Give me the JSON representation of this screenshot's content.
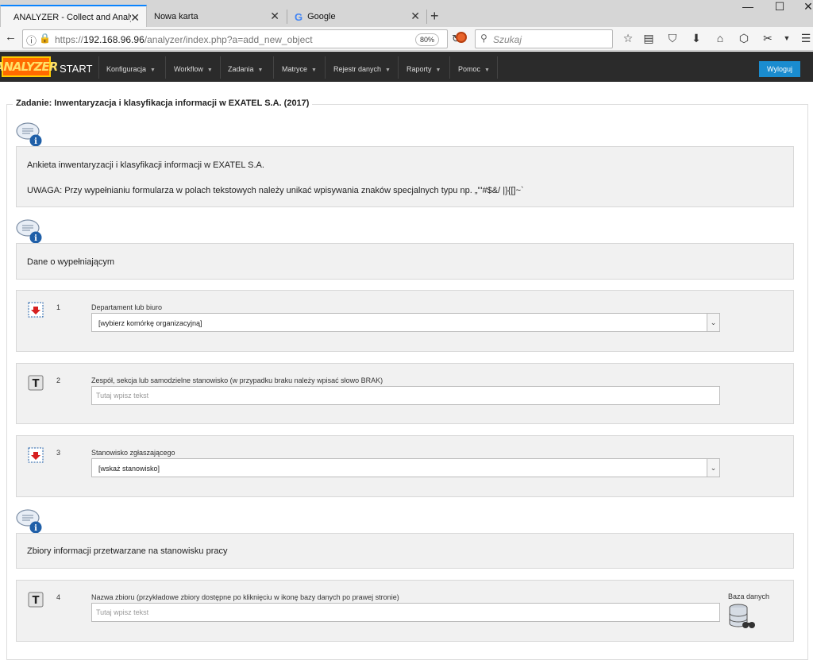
{
  "browser": {
    "tabs": [
      {
        "title": "ANALYZER - Collect and Analysis",
        "active": true
      },
      {
        "title": "Nowa karta",
        "active": false
      },
      {
        "title": "Google",
        "active": false
      }
    ],
    "new_tab_icon": "plus-icon",
    "url_prefix": "https://",
    "url_host": "192.168.96.96",
    "url_path": "/analyzer/index.php?a=add_new_object",
    "zoom": "80%",
    "search_placeholder": "Szukaj"
  },
  "app": {
    "logo_text": "ANALYZER",
    "start_label": "START",
    "menu": [
      {
        "label": "Konfiguracja"
      },
      {
        "label": "Workflow"
      },
      {
        "label": "Zadania"
      },
      {
        "label": "Matryce"
      },
      {
        "label": "Rejestr danych"
      },
      {
        "label": "Raporty"
      },
      {
        "label": "Pomoc"
      }
    ],
    "logout_label": "Wyloguj",
    "accent_color": "#1a8ccf"
  },
  "task": {
    "legend": "Zadanie: Inwentaryzacja i klasyfikacja informacji w EXATEL S.A. (2017)",
    "intro_line1": "Ankieta inwentaryzacji i klasyfikacji informacji w EXATEL S.A.",
    "intro_line2": "UWAGA: Przy wypełnianiu formularza w polach tekstowych należy unikać wpisywania znaków specjalnych typu np. „\"'#$&/ |}{[]~`",
    "section1_title": "Dane o wypełniającym",
    "section2_title": "Zbiory informacji przetwarzane na stanowisku pracy",
    "questions": [
      {
        "number": "1",
        "label": "Departament lub biuro",
        "type": "select",
        "value": "[wybierz komórkę organizacyjną]"
      },
      {
        "number": "2",
        "label": "Zespół, sekcja lub samodzielne stanowisko (w przypadku braku należy wpisać słowo BRAK)",
        "type": "text",
        "placeholder": "Tutaj wpisz tekst"
      },
      {
        "number": "3",
        "label": "Stanowisko zgłaszającego",
        "type": "select",
        "value": "[wskaż stanowisko]"
      },
      {
        "number": "4",
        "label": "Nazwa zbioru (przykładowe zbiory dostępne po kliknięciu w ikonę bazy danych po prawej stronie)",
        "type": "text",
        "placeholder": "Tutaj wpisz tekst",
        "side_label": "Baza danych"
      }
    ]
  }
}
